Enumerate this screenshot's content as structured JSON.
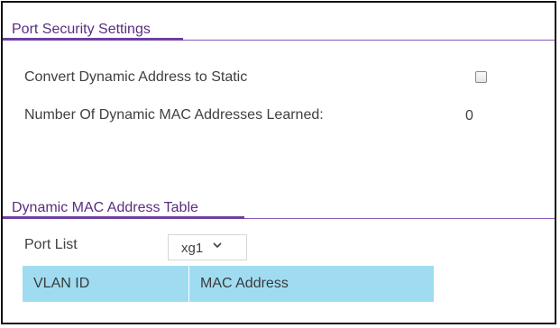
{
  "port_security": {
    "title": "Port Security Settings",
    "convert_label": "Convert Dynamic Address to Static",
    "convert_checked": false,
    "learned_label": "Number Of Dynamic MAC Addresses Learned:",
    "learned_value": "0"
  },
  "dynamic_table": {
    "title": "Dynamic MAC Address Table",
    "port_list_label": "Port List",
    "port_list_selected": "xg1",
    "columns": [
      "VLAN ID",
      "MAC Address"
    ]
  },
  "colors": {
    "section_title": "#5a2d80",
    "section_underline": "#6e3fa0",
    "table_header_bg": "#9fdcf2"
  },
  "icons": {
    "dropdown": "chevron-down-icon"
  }
}
